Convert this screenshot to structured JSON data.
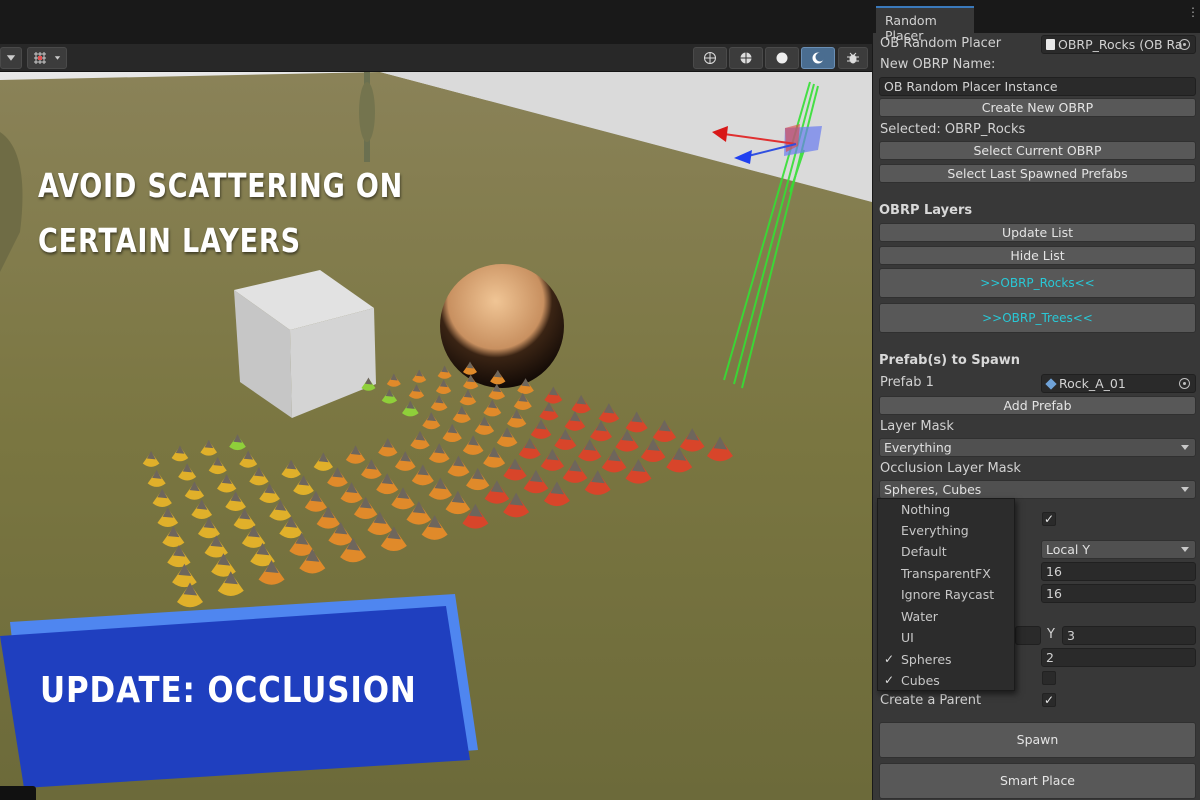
{
  "scene": {
    "headline_line1": "AVOID SCATTERING ON",
    "headline_line2": "CERTAIN LAYERS",
    "banner": "UPDATE: OCCLUSION",
    "banner_color": "#1f3fbf",
    "banner_accent": "#4f86f0"
  },
  "panel": {
    "tab": "Random Placer",
    "ob_random_placer_label": "OB Random Placer",
    "ob_random_placer_value": "OBRP_Rocks (OB Ra",
    "new_obrp_name_label": "New OBRP Name:",
    "new_obrp_name_value": "OB Random Placer Instance",
    "create_new_button": "Create New OBRP",
    "selected_text": "Selected: OBRP_Rocks",
    "select_current_button": "Select Current OBRP",
    "select_last_button": "Select Last Spawned Prefabs",
    "layers_header": "OBRP Layers",
    "update_list_button": "Update List",
    "hide_list_button": "Hide List",
    "layer_rocks": ">>OBRP_Rocks<<",
    "layer_trees": ">>OBRP_Trees<<",
    "prefabs_header": "Prefab(s) to Spawn",
    "prefab1_label": "Prefab 1",
    "prefab1_value": "Rock_A_01",
    "add_prefab_button": "Add Prefab",
    "layer_mask_label": "Layer Mask",
    "layer_mask_value": "Everything",
    "occlusion_label": "Occlusion Layer Mask",
    "occlusion_value": "Spheres, Cubes",
    "axis_value": "Local Y",
    "field_a": "16",
    "field_b": "16",
    "y_label": "Y",
    "y_value": "3",
    "field_c": "2",
    "create_parent_label": "Create a Parent",
    "spawn_button": "Spawn",
    "smart_place_button": "Smart Place"
  },
  "popup": {
    "items": [
      {
        "label": "Nothing",
        "checked": false
      },
      {
        "label": "Everything",
        "checked": false
      },
      {
        "label": "Default",
        "checked": false
      },
      {
        "label": "TransparentFX",
        "checked": false
      },
      {
        "label": "Ignore Raycast",
        "checked": false
      },
      {
        "label": "Water",
        "checked": false
      },
      {
        "label": "UI",
        "checked": false
      },
      {
        "label": "Spheres",
        "checked": true
      },
      {
        "label": "Cubes",
        "checked": true
      }
    ],
    "check_glyph": "✓"
  },
  "toolbar_icons": [
    "dropdown-arrow-icon",
    "grid-snap-icon",
    "wireframe-globe-icon",
    "shaded-wireframe-icon",
    "shaded-sphere-icon",
    "lighting-icon",
    "gizmo-bug-icon"
  ]
}
